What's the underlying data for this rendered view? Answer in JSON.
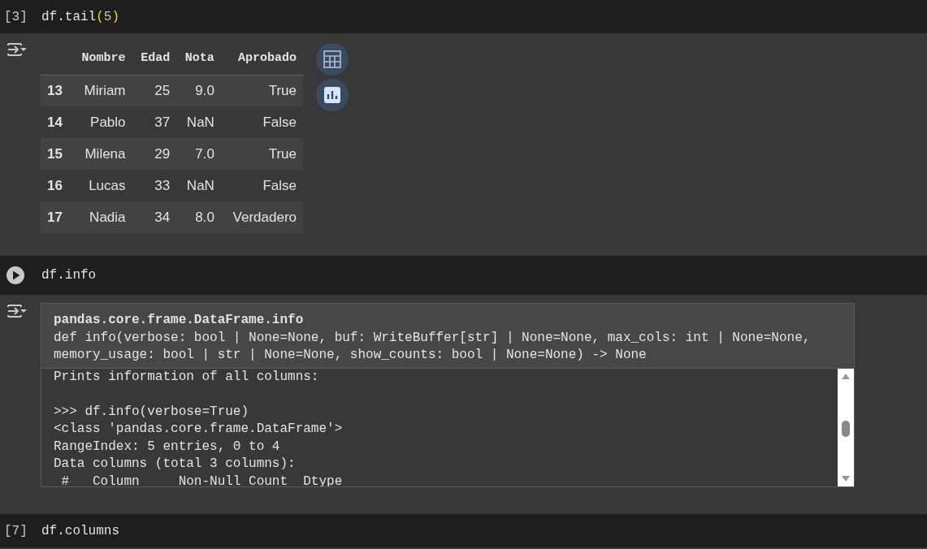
{
  "cells": [
    {
      "kind": "executed",
      "prompt": "[3]",
      "code": [
        {
          "text": "df.tail",
          "kind": "plain"
        },
        {
          "text": "(",
          "kind": "paren"
        },
        {
          "text": "5",
          "kind": "number"
        },
        {
          "text": ")",
          "kind": "paren"
        }
      ],
      "output": {
        "kind": "dataframe",
        "columns": [
          "Nombre",
          "Edad",
          "Nota",
          "Aprobado"
        ],
        "rows": [
          {
            "index": "13",
            "cells": [
              "Miriam",
              "25",
              "9.0",
              "True"
            ]
          },
          {
            "index": "14",
            "cells": [
              "Pablo",
              "37",
              "NaN",
              "False"
            ]
          },
          {
            "index": "15",
            "cells": [
              "Milena",
              "29",
              "7.0",
              "True"
            ]
          },
          {
            "index": "16",
            "cells": [
              "Lucas",
              "33",
              "NaN",
              "False"
            ]
          },
          {
            "index": "17",
            "cells": [
              "Nadia",
              "34",
              "8.0",
              "Verdadero"
            ]
          }
        ]
      }
    },
    {
      "kind": "run_button",
      "code": [
        {
          "text": "df.info",
          "kind": "plain"
        }
      ],
      "output": {
        "kind": "docstring",
        "title": "pandas.core.frame.DataFrame.info",
        "signature": [
          "def info(verbose: bool | None=None, buf: WriteBuffer[str] | None=None, max_cols: int | None=None,",
          "memory_usage: bool | str | None=None, show_counts: bool | None=None) -> None"
        ],
        "paragraphs": [
          [
            "Prints information of all columns:"
          ],
          [
            ">>> df.info(verbose=True)",
            "<class 'pandas.core.frame.DataFrame'>",
            "RangeIndex: 5 entries, 0 to 4",
            "Data columns (total 3 columns):",
            " #   Column     Non-Null Count  Dtype"
          ]
        ]
      }
    },
    {
      "kind": "executed",
      "prompt": "[7]",
      "code": [
        {
          "text": "df.columns",
          "kind": "plain"
        }
      ]
    }
  ]
}
